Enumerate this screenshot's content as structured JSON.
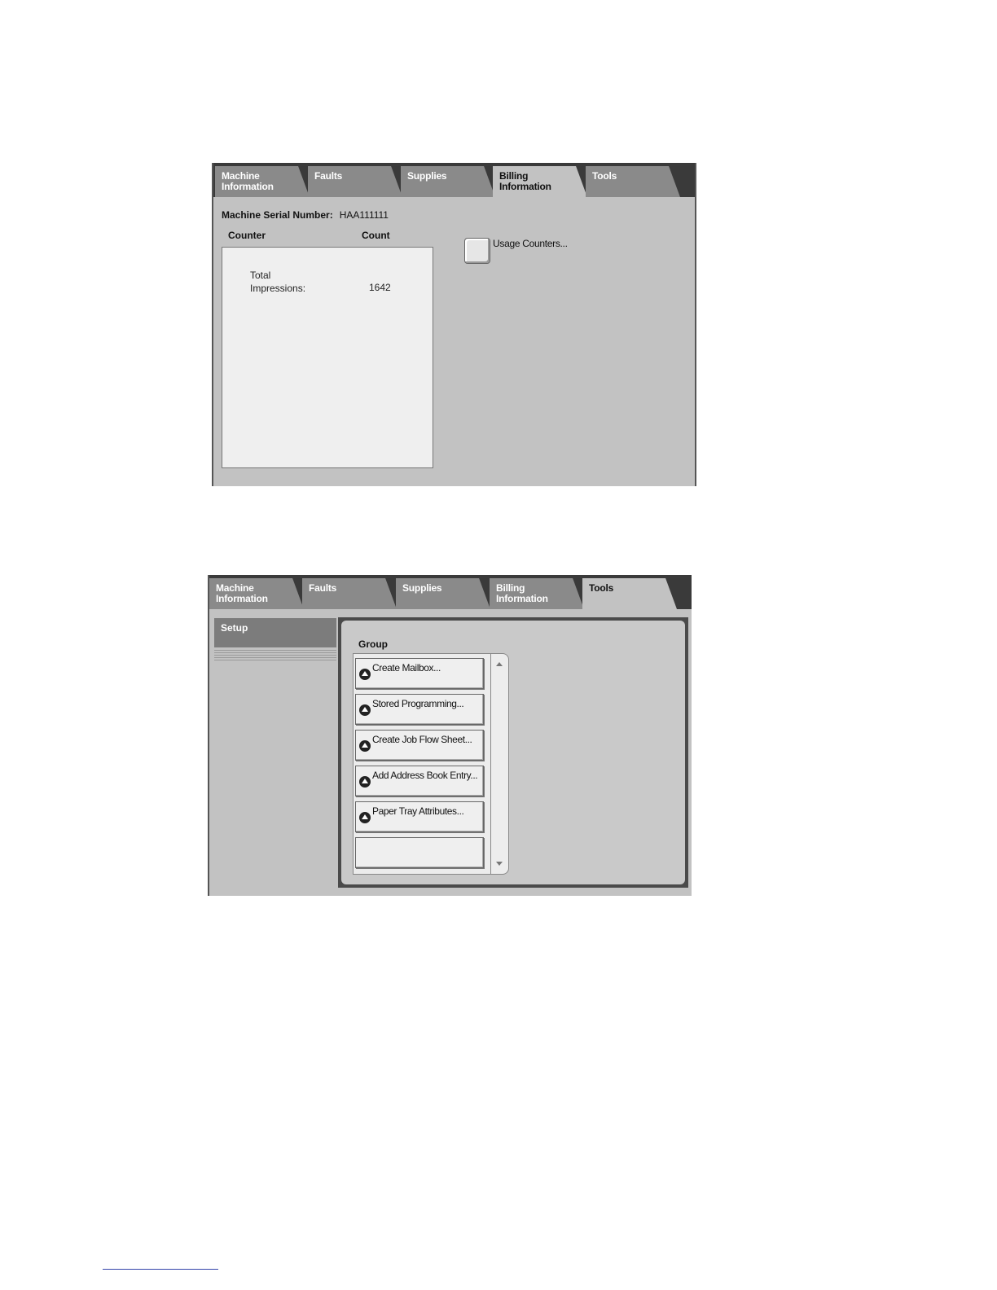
{
  "billing_screen": {
    "tabs": [
      {
        "line1": "Machine",
        "line2": "Information"
      },
      {
        "line1": "Faults",
        "line2": ""
      },
      {
        "line1": "Supplies",
        "line2": ""
      },
      {
        "line1": "Billing",
        "line2": "Information"
      },
      {
        "line1": "Tools",
        "line2": ""
      }
    ],
    "active_tab": "Billing Information",
    "serial_label": "Machine Serial Number:",
    "serial_value": "HAA111111",
    "counter_header": "Counter",
    "count_header": "Count",
    "counter_row": {
      "label": "Total Impressions:",
      "count": "1642"
    },
    "usage_button_label": "Usage Counters..."
  },
  "tools_screen": {
    "tabs": [
      {
        "line1": "Machine",
        "line2": "Information"
      },
      {
        "line1": "Faults",
        "line2": ""
      },
      {
        "line1": "Supplies",
        "line2": ""
      },
      {
        "line1": "Billing",
        "line2": "Information"
      },
      {
        "line1": "Tools",
        "line2": ""
      }
    ],
    "active_tab": "Tools",
    "sidebar_item": "Setup",
    "group_title": "Group",
    "group_items": [
      "Create Mailbox...",
      "Stored Programming...",
      "Create Job Flow Sheet...",
      "Add Address Book Entry...",
      "Paper Tray Attributes..."
    ]
  }
}
